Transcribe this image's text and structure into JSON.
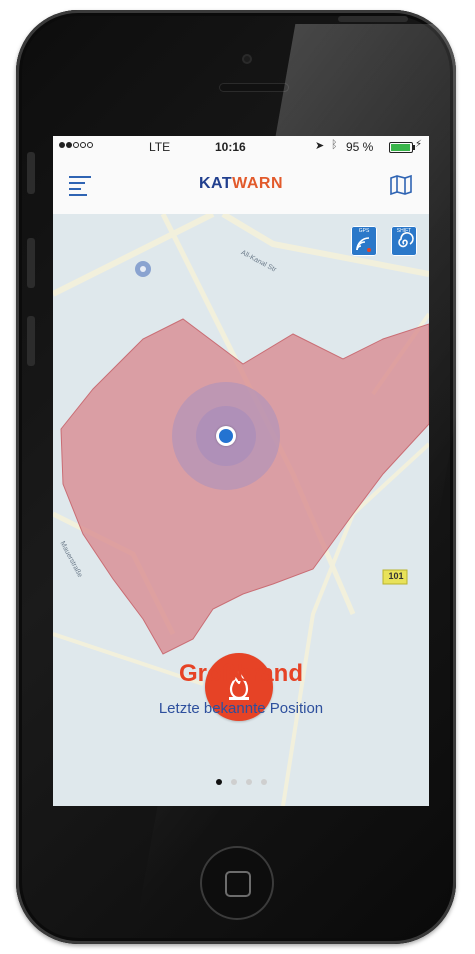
{
  "status_bar": {
    "carrier": "LTE",
    "time": "10:16",
    "battery_percent": "95 %",
    "battery_level": 0.95,
    "signal_bars_filled": 2,
    "signal_bars_total": 5
  },
  "nav": {
    "brand_kat": "KAT",
    "brand_warn": "WARN",
    "menu_icon": "hamburger-menu-icon",
    "map_icon": "map-icon"
  },
  "map": {
    "street_1": "All-Kanal Str",
    "street_2": "Mauerstraße",
    "road_badge": "101",
    "control_1_label": "GPS",
    "control_2_label": "SHIFT"
  },
  "alert": {
    "title": "Großbrand",
    "subtitle": "Letzte bekannte Position",
    "icon": "fire-icon",
    "color": "#e64326"
  },
  "pager": {
    "count": 4,
    "active_index": 0
  },
  "colors": {
    "brand_blue": "#213f8e",
    "brand_orange": "#e25a2b",
    "hazard_zone": "#d9898f"
  }
}
